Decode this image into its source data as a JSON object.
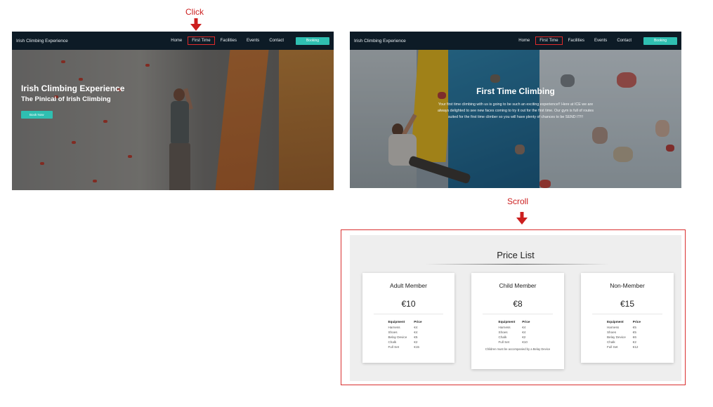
{
  "annotations": {
    "click": "Click",
    "scroll": "Scroll"
  },
  "site": {
    "brand": "Irish Climbing Experience",
    "nav": [
      "Home",
      "First Time",
      "Facilities",
      "Events",
      "Contact"
    ],
    "booking": "Booking"
  },
  "hero": {
    "title": "Irish Climbing Experience",
    "subtitle": "The Pinical of Irish Climbing",
    "button": "Book Now"
  },
  "first_time": {
    "title": "First Time Climbing",
    "paragraph": "Your first time climbing with us is going to be such an exciting experience!! Here at ICE we are always delighted to see new faces coming to try it out for the first time. Our gym is full of routes suited for the first time climber so you will have plenty of chances to be SEND IT!!!"
  },
  "price_list": {
    "title": "Price List",
    "col_equipment": "Equipment",
    "col_price": "Price",
    "cards": [
      {
        "name": "Adult Member",
        "price": "€10",
        "rows": [
          [
            "Harness",
            "€4"
          ],
          [
            "Shoes",
            "€4"
          ],
          [
            "Belay Device",
            "€5"
          ],
          [
            "Chalk",
            "€2"
          ],
          [
            "Full Set",
            "€15"
          ]
        ],
        "note": ""
      },
      {
        "name": "Child Member",
        "price": "€8",
        "rows": [
          [
            "Harness",
            "€4"
          ],
          [
            "Shoes",
            "€4"
          ],
          [
            "Chalk",
            "€2"
          ],
          [
            "Full Set",
            "€10"
          ]
        ],
        "note": "Children must be accompanied by a Belay Device"
      },
      {
        "name": "Non-Member",
        "price": "€15",
        "rows": [
          [
            "Harness",
            "€5"
          ],
          [
            "Shoes",
            "€5"
          ],
          [
            "Belay Device",
            "€6"
          ],
          [
            "Chalk",
            "€2"
          ],
          [
            "Full Set",
            "€12"
          ]
        ],
        "note": ""
      }
    ]
  },
  "colors": {
    "accent": "#2fbfb1",
    "nav_bg": "#0d1b26",
    "annotation_red": "#cc1f1f"
  }
}
